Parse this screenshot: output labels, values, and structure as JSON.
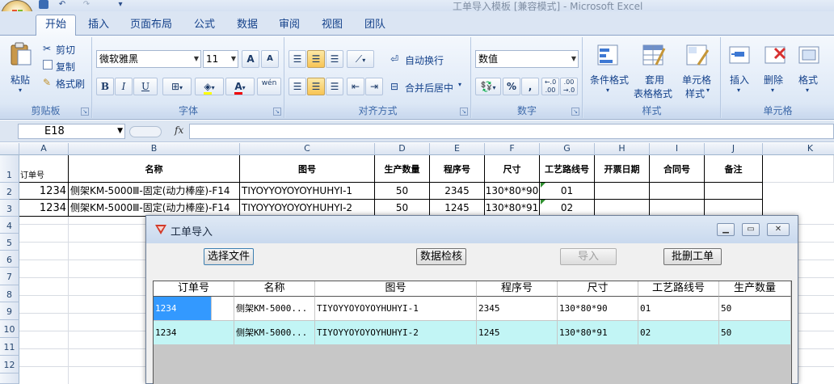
{
  "window": {
    "title": "工单导入模板  [兼容模式] - Microsoft Excel"
  },
  "tabs": [
    "开始",
    "插入",
    "页面布局",
    "公式",
    "数据",
    "审阅",
    "视图",
    "团队"
  ],
  "ribbon": {
    "clipboard": {
      "label": "剪贴板",
      "paste": "粘贴",
      "cut": "剪切",
      "copy": "复制",
      "format_painter": "格式刷"
    },
    "font": {
      "label": "字体",
      "name": "微软雅黑",
      "size": "11",
      "bold": "B",
      "italic": "I",
      "underline": "U",
      "grow": "A",
      "shrink": "A",
      "color_a": "A",
      "phonetic": "wén"
    },
    "alignment": {
      "label": "对齐方式",
      "wrap": "自动换行",
      "merge": "合并后居中"
    },
    "number": {
      "label": "数字",
      "format": "数值",
      "percent": "%",
      "comma": ","
    },
    "styles": {
      "label": "样式",
      "conditional": "条件格式",
      "table_line1": "套用",
      "table_line2": "表格格式",
      "cell_styles_line1": "单元格",
      "cell_styles_line2": "样式"
    },
    "cells": {
      "label": "单元格",
      "insert": "插入",
      "delete": "删除",
      "format": "格式"
    }
  },
  "formula_bar": {
    "name_box": "E18",
    "fx": "fx",
    "value": ""
  },
  "sheet": {
    "columns": [
      "A",
      "B",
      "C",
      "D",
      "E",
      "F",
      "G",
      "H",
      "I",
      "J",
      "K"
    ],
    "rows": [
      "1",
      "2",
      "3",
      "4",
      "5",
      "6",
      "7",
      "8",
      "9",
      "10",
      "11",
      "12"
    ],
    "header_row": [
      "订单号",
      "名称",
      "图号",
      "生产数量",
      "程序号",
      "尺寸",
      "工艺路线号",
      "开票日期",
      "合同号",
      "备注"
    ],
    "data": [
      [
        "1234",
        "侧架KM-5000Ⅲ-固定(动力棒座)-F14",
        "TIYOYYOYOYOYHUHYI-1",
        "50",
        "2345",
        "130*80*90",
        "01",
        "",
        "",
        ""
      ],
      [
        "1234",
        "侧架KM-5000Ⅲ-固定(动力棒座)-F14",
        "TIYOYYOYOYOYHUHYI-2",
        "50",
        "1245",
        "130*80*91",
        "02",
        "",
        "",
        ""
      ]
    ]
  },
  "dialog": {
    "title": "工单导入",
    "buttons": {
      "choose_file": "选择文件",
      "check": "数据检核",
      "import": "导入",
      "batch_delete": "批删工单"
    },
    "grid": {
      "columns": [
        "订单号",
        "名称",
        "图号",
        "程序号",
        "尺寸",
        "工艺路线号",
        "生产数量"
      ],
      "rows": [
        [
          "1234",
          "侧架KM-5000...",
          "TIYOYYOYOYOYHUHYI-1",
          "2345",
          "130*80*90",
          "01",
          "50"
        ],
        [
          "1234",
          "侧架KM-5000...",
          "TIYOYYOYOYOYHUHYI-2",
          "1245",
          "130*80*91",
          "02",
          "50"
        ]
      ]
    }
  },
  "colors": {
    "ribbon_text": "#15428b",
    "selected_cell": "#3399ff",
    "alt_row": "#c2f5f5",
    "dialog_bg": "#f0f0f0"
  }
}
